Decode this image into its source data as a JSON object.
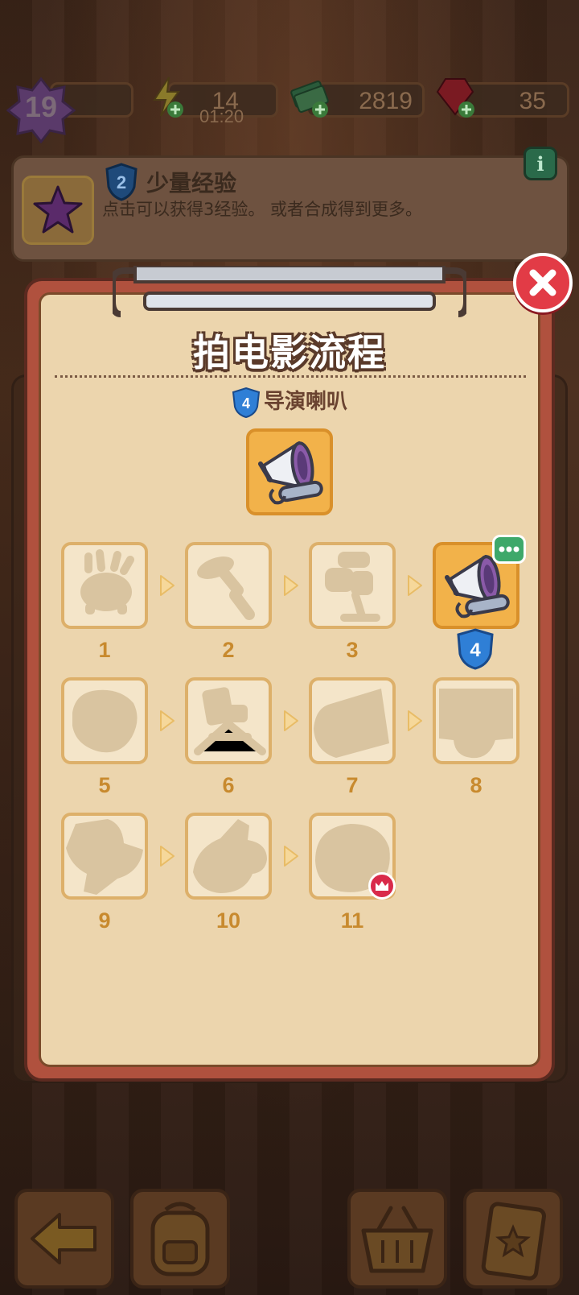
{
  "resources": {
    "level": "19",
    "energy": "14",
    "energy_timer": "01:20",
    "cash": "2819",
    "gems": "35"
  },
  "info_card": {
    "level": "2",
    "title": "少量经验",
    "description": "点击可以获得3经验。 或者合成得到更多。",
    "info_button": "i"
  },
  "modal": {
    "title": "拍电影流程",
    "item_level": "4",
    "item_name": "导演喇叭",
    "current_level_badge": "4",
    "chain": [
      {
        "n": "1",
        "state": "locked"
      },
      {
        "n": "2",
        "state": "locked"
      },
      {
        "n": "3",
        "state": "locked"
      },
      {
        "n": "4",
        "state": "current"
      },
      {
        "n": "5",
        "state": "locked"
      },
      {
        "n": "6",
        "state": "locked"
      },
      {
        "n": "7",
        "state": "locked"
      },
      {
        "n": "8",
        "state": "locked"
      },
      {
        "n": "9",
        "state": "locked"
      },
      {
        "n": "10",
        "state": "locked"
      },
      {
        "n": "11",
        "state": "locked-max"
      }
    ]
  },
  "colors": {
    "modal_bg": "#ecd5ad",
    "modal_frame": "#b0513e",
    "tile_border": "#ddb06a",
    "current_tile": "#f2b24a",
    "number": "#c88a2e",
    "close": "#e23b46",
    "shield_blue": "#2f7fd6"
  },
  "icons": {
    "level": "purple-star-badge-icon",
    "energy": "lightning-icon",
    "cash": "cash-stack-icon",
    "gems": "red-gem-icon",
    "item": "megaphone-icon",
    "close": "close-icon",
    "crown": "crown-icon",
    "chat": "chat-bubble-icon"
  },
  "bottom_bar": {
    "buttons": [
      "back-arrow-icon",
      "backpack-icon",
      "basket-icon",
      "clipboard-star-icon"
    ]
  }
}
